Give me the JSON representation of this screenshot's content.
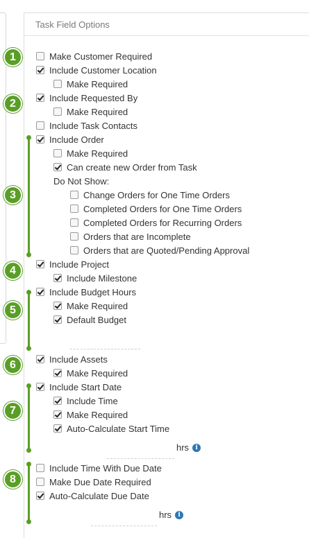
{
  "panel": {
    "title": "Task Field Options"
  },
  "badges": [
    "1",
    "2",
    "3",
    "4",
    "5",
    "6",
    "7",
    "8"
  ],
  "options": {
    "make_customer_required": {
      "label": "Make Customer Required",
      "checked": false
    },
    "include_customer_location": {
      "label": "Include Customer Location",
      "checked": true
    },
    "location_make_required": {
      "label": "Make Required",
      "checked": false
    },
    "include_requested_by": {
      "label": "Include Requested By",
      "checked": true
    },
    "requested_make_required": {
      "label": "Make Required",
      "checked": false
    },
    "include_task_contacts": {
      "label": "Include Task Contacts",
      "checked": false
    },
    "include_order": {
      "label": "Include Order",
      "checked": true
    },
    "order_make_required": {
      "label": "Make Required",
      "checked": false
    },
    "can_create_order": {
      "label": "Can create new Order from Task",
      "checked": true
    },
    "do_not_show_label": "Do Not Show:",
    "change_orders_one_time": {
      "label": "Change Orders for One Time Orders",
      "checked": false
    },
    "completed_orders_one_time": {
      "label": "Completed Orders for One Time Orders",
      "checked": false
    },
    "completed_orders_recurring": {
      "label": "Completed Orders for Recurring Orders",
      "checked": false
    },
    "orders_incomplete": {
      "label": "Orders that are Incomplete",
      "checked": false
    },
    "orders_quoted_pending": {
      "label": "Orders that are Quoted/Pending Approval",
      "checked": false
    },
    "include_project": {
      "label": "Include Project",
      "checked": true
    },
    "include_milestone": {
      "label": "Include Milestone",
      "checked": true
    },
    "include_budget_hours": {
      "label": "Include Budget Hours",
      "checked": true
    },
    "budget_make_required": {
      "label": "Make Required",
      "checked": true
    },
    "default_budget": {
      "label": "Default Budget",
      "checked": true
    },
    "include_assets": {
      "label": "Include Assets",
      "checked": true
    },
    "assets_make_required": {
      "label": "Make Required",
      "checked": true
    },
    "include_start_date": {
      "label": "Include Start Date",
      "checked": true
    },
    "start_include_time": {
      "label": "Include Time",
      "checked": true
    },
    "start_make_required": {
      "label": "Make Required",
      "checked": true
    },
    "auto_calc_start_time": {
      "label": "Auto-Calculate Start Time",
      "checked": true
    },
    "include_time_due_date": {
      "label": "Include Time With Due Date",
      "checked": false
    },
    "make_due_date_required": {
      "label": "Make Due Date Required",
      "checked": false
    },
    "auto_calc_due_date": {
      "label": "Auto-Calculate Due Date",
      "checked": true
    }
  },
  "units": {
    "start_hrs": "hrs",
    "due_hrs": "hrs"
  },
  "icons": {
    "info": "info-icon",
    "info_glyph": "i"
  },
  "colors": {
    "accent_green": "#5a9e27",
    "info_blue": "#2f77b6"
  }
}
